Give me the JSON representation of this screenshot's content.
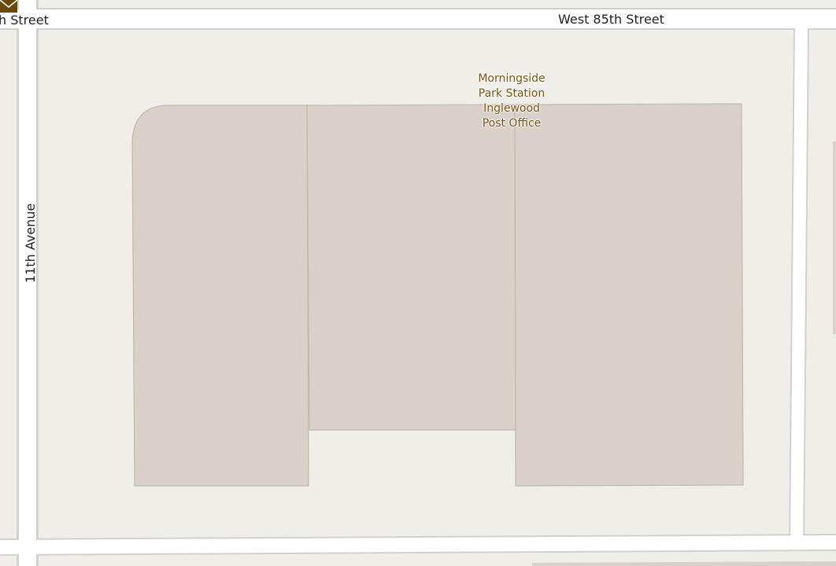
{
  "map": {
    "colors": {
      "land": "#f0eee9",
      "road": "#ffffff",
      "road_casing": "#d3d1cc",
      "building": "#d8d0c9",
      "building_outline": "#c2b8ae",
      "poi_text": "#7a5614"
    },
    "streets": {
      "top_left_fragment": "h Street",
      "top_main": "West 85th Street",
      "left_avenue": "11th Avenue"
    },
    "poi": {
      "icon": "envelope-icon",
      "name_lines": [
        "Morningside",
        "Park Station",
        "Inglewood",
        "Post Office"
      ]
    }
  }
}
